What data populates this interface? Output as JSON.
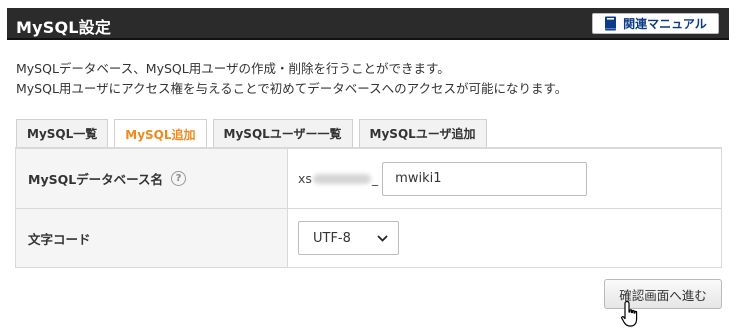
{
  "header": {
    "title": "MySQL設定",
    "manual_button_label": "関連マニュアル"
  },
  "description": {
    "line1": "MySQLデータベース、MySQL用ユーザの作成・削除を行うことができます。",
    "line2": "MySQL用ユーザにアクセス権を与えることで初めてデータベースへのアクセスが可能になります。"
  },
  "tabs": [
    {
      "label": "MySQL一覧",
      "active": false
    },
    {
      "label": "MySQL追加",
      "active": true
    },
    {
      "label": "MySQLユーザー一覧",
      "active": false
    },
    {
      "label": "MySQLユーザ追加",
      "active": false
    }
  ],
  "form": {
    "db_name": {
      "label": "MySQLデータベース名",
      "help": "?",
      "prefix_start": "xs",
      "prefix_end": "_",
      "value": "mwiki1"
    },
    "charset": {
      "label": "文字コード",
      "selected": "UTF-8"
    }
  },
  "confirm_button_label": "確認画面へ進む",
  "colors": {
    "header_bg": "#2b2b2b",
    "active_tab": "#f08a1c",
    "manual_text": "#0b3a86"
  }
}
